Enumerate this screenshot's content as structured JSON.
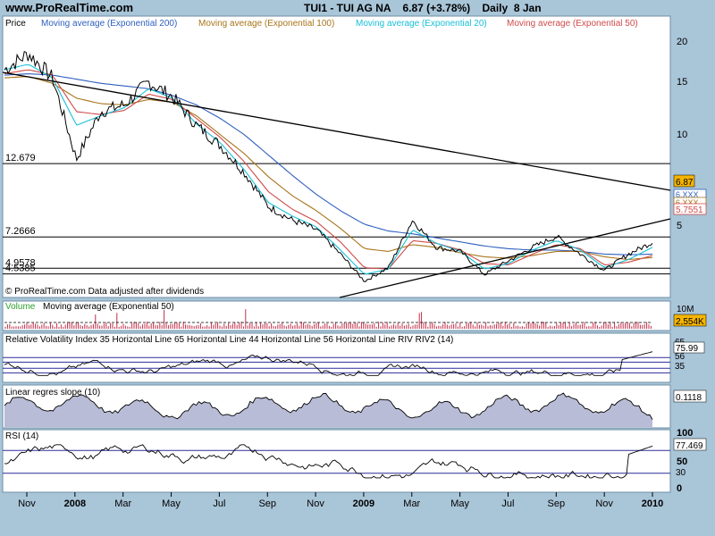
{
  "header": {
    "site": "www.ProRealTime.com",
    "title": "TUI1 - TUI AG NA    6.87 (+3.78%)    Daily  8 Jan"
  },
  "colors": {
    "background": "#a9c5d8",
    "panel": "#ffffff",
    "price": "#000000",
    "ema200": "#2e5fbf",
    "ema100": "#a8741a",
    "ema20": "#17c0d8",
    "ema50": "#d04a4a",
    "volume": "#c0304a",
    "fill": "#b9bcd6"
  },
  "chart_data": [
    {
      "type": "line",
      "panel": "price",
      "legend": [
        "Price",
        "Moving average (Exponential 200)",
        "Moving average (Exponential 100)",
        "Moving average (Exponential 20)",
        "Moving average (Exponential 50)"
      ],
      "yticks": [
        "20",
        "15",
        "10",
        "5"
      ],
      "ylim": [
        3.0,
        22.5
      ],
      "hlines": [
        {
          "label": "12.679",
          "value": 12.679
        },
        {
          "label": "7.2666",
          "value": 7.2666
        },
        {
          "label": "4.9578",
          "value": 4.9578
        },
        {
          "label": "4.5385",
          "value": 4.5385
        }
      ],
      "value_tags": [
        "6.87",
        "6.XXX",
        "6.XXX",
        "5.7551"
      ],
      "note": "© ProRealTime.com  Data adjusted after dividends",
      "x": [
        "Nov",
        "2008",
        "Mar",
        "May",
        "Jul",
        "Sep",
        "Nov",
        "2009",
        "Mar",
        "May",
        "Jul",
        "Sep",
        "Nov",
        "2010"
      ],
      "series": [
        {
          "name": "Price",
          "values": [
            19.6,
            20.8,
            19.0,
            13.0,
            16.5,
            17.0,
            18.7,
            17.6,
            15.5,
            14.0,
            12.0,
            9.5,
            8.5,
            7.8,
            6.0,
            4.0,
            5.0,
            8.5,
            6.5,
            6.2,
            4.5,
            5.5,
            6.5,
            7.3,
            6.0,
            4.8,
            6.0,
            6.87
          ]
        },
        {
          "name": "Moving average (Exponential 200)",
          "values": [
            19.2,
            19.3,
            19.2,
            18.9,
            18.6,
            18.4,
            18.2,
            17.7,
            17.0,
            16.0,
            14.8,
            13.3,
            11.8,
            10.4,
            9.2,
            8.2,
            7.7,
            7.5,
            7.2,
            6.9,
            6.6,
            6.4,
            6.3,
            6.3,
            6.2,
            6.0,
            5.95,
            6.0
          ]
        },
        {
          "name": "Moving average (Exponential 100)",
          "values": [
            19.0,
            19.1,
            18.6,
            17.5,
            17.1,
            17.0,
            17.4,
            17.2,
            16.2,
            14.8,
            13.4,
            11.7,
            10.3,
            9.2,
            7.9,
            6.4,
            6.2,
            6.7,
            6.5,
            6.1,
            5.8,
            5.7,
            5.9,
            6.2,
            6.2,
            5.8,
            5.6,
            5.75
          ]
        },
        {
          "name": "Moving average (Exponential 20)",
          "values": [
            19.6,
            20.0,
            19.0,
            15.5,
            16.2,
            16.8,
            18.2,
            17.5,
            15.6,
            14.2,
            12.2,
            9.8,
            8.8,
            8.0,
            6.3,
            4.5,
            4.9,
            7.8,
            6.8,
            6.2,
            4.9,
            5.3,
            6.3,
            7.0,
            6.3,
            5.0,
            5.6,
            6.5
          ]
        },
        {
          "name": "Moving average (Exponential 50)",
          "values": [
            19.3,
            19.6,
            19.2,
            16.5,
            16.3,
            16.6,
            17.8,
            17.4,
            16.0,
            14.6,
            12.8,
            10.6,
            9.3,
            8.4,
            6.9,
            5.0,
            4.9,
            7.0,
            6.8,
            6.3,
            5.3,
            5.2,
            6.0,
            6.7,
            6.4,
            5.2,
            5.4,
            5.9
          ]
        }
      ]
    },
    {
      "type": "bar",
      "panel": "volume",
      "legend": [
        "Volume",
        "Moving average (Exponential 50)"
      ],
      "yticks": [
        "10M"
      ],
      "value_tag": "2,554K"
    },
    {
      "type": "line",
      "panel": "rvi",
      "legend": [
        "Relative Volatility Index 35 Horizontal Line 65 Horizontal Line 44 Horizontal Line 56 Horizontal Line RIV RIV2 (14)"
      ],
      "hlines_values": [
        35,
        44,
        56,
        65
      ],
      "value_tags": [
        "65",
        "75.99",
        "56",
        "35"
      ]
    },
    {
      "type": "area",
      "panel": "slope",
      "legend": [
        "Linear regres slope (10)"
      ],
      "value_tag": "0.1118"
    },
    {
      "type": "line",
      "panel": "rsi",
      "legend": [
        "RSI (14)"
      ],
      "yticks": [
        "100",
        "50",
        "0"
      ],
      "hlines_values": [
        30,
        70
      ],
      "value_tags": [
        "77.469",
        "30"
      ]
    }
  ],
  "xaxis": {
    "labels": [
      {
        "text": "Nov",
        "bold": false
      },
      {
        "text": "2008",
        "bold": true
      },
      {
        "text": "Mar",
        "bold": false
      },
      {
        "text": "May",
        "bold": false
      },
      {
        "text": "Jul",
        "bold": false
      },
      {
        "text": "Sep",
        "bold": false
      },
      {
        "text": "Nov",
        "bold": false
      },
      {
        "text": "2009",
        "bold": true
      },
      {
        "text": "Mar",
        "bold": false
      },
      {
        "text": "May",
        "bold": false
      },
      {
        "text": "Jul",
        "bold": false
      },
      {
        "text": "Sep",
        "bold": false
      },
      {
        "text": "Nov",
        "bold": false
      },
      {
        "text": "2010",
        "bold": true
      }
    ]
  }
}
